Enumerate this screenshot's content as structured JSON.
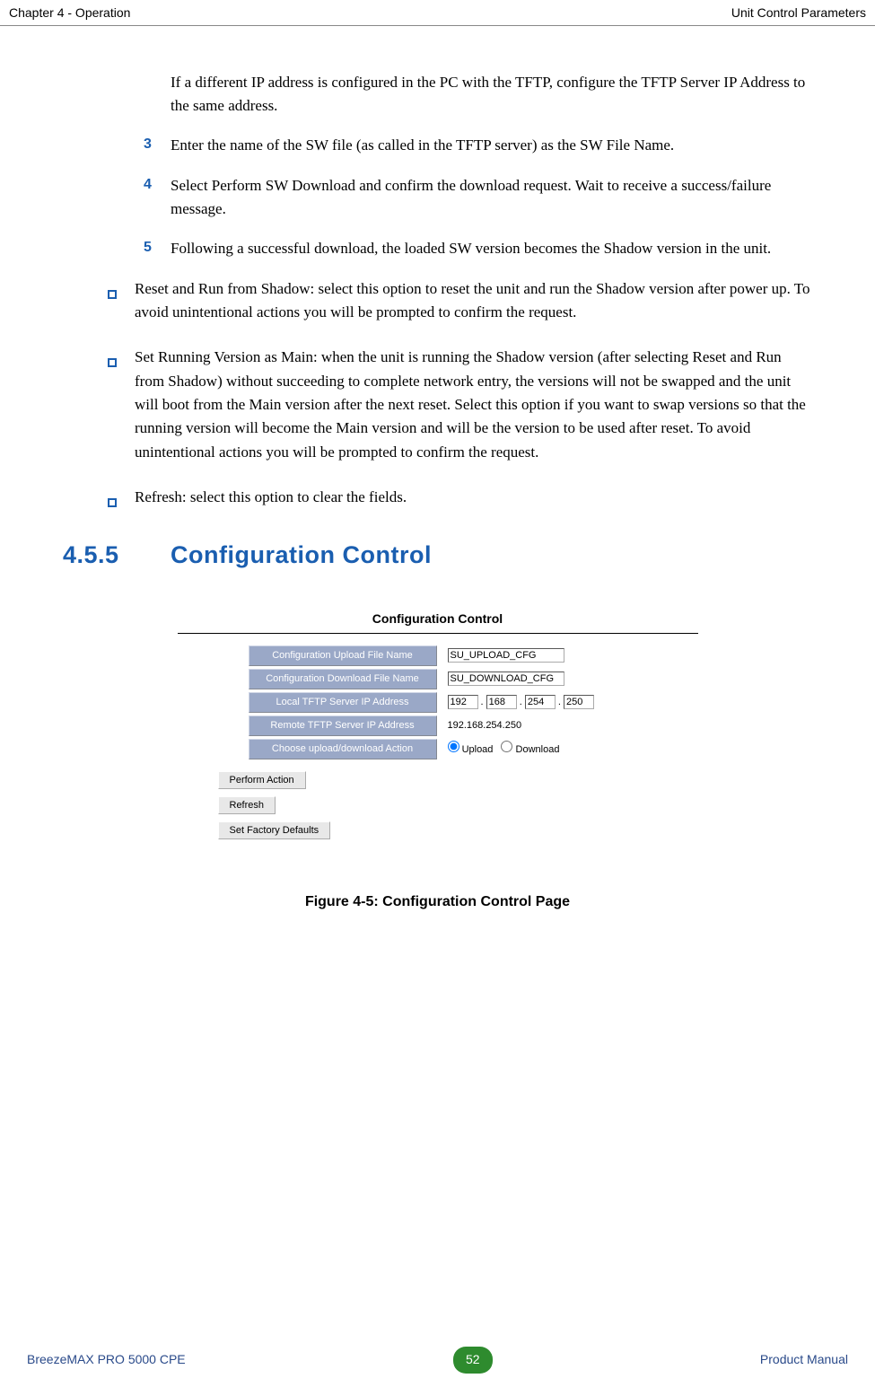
{
  "header": {
    "left": "Chapter 4 - Operation",
    "right": "Unit Control Parameters"
  },
  "body": {
    "intro": "If a different IP address is configured in the PC with the TFTP, configure the TFTP Server IP Address to the same address.",
    "steps": [
      {
        "num": "3",
        "text": "Enter the name of the SW file (as called in the TFTP server) as the SW File Name."
      },
      {
        "num": "4",
        "text": "Select Perform SW Download and confirm the download request. Wait to receive a success/failure message."
      },
      {
        "num": "5",
        "text": "Following a successful download, the loaded SW version becomes the Shadow version in the unit."
      }
    ],
    "bullets": [
      "Reset and Run from Shadow: select this option to reset the unit and run the Shadow version after power up. To avoid unintentional actions you will be prompted to confirm the request.",
      "Set Running Version as Main: when the unit is running the Shadow version (after selecting Reset and Run from Shadow) without succeeding to complete network entry, the versions will not be swapped and the unit will boot from the Main version after the next reset. Select this option if you want to swap versions so that the running version will become the Main version and will be the version to be used after reset. To avoid unintentional actions you will be prompted to confirm the request.",
      "Refresh: select this option to clear the fields."
    ]
  },
  "section": {
    "number": "4.5.5",
    "title": "Configuration Control"
  },
  "figure": {
    "heading": "Configuration Control",
    "rows": {
      "upload_name": {
        "label": "Configuration Upload File Name",
        "value": "SU_UPLOAD_CFG"
      },
      "download_name": {
        "label": "Configuration Download File Name",
        "value": "SU_DOWNLOAD_CFG"
      },
      "local_ip": {
        "label": "Local TFTP Server IP Address",
        "oct1": "192",
        "oct2": "168",
        "oct3": "254",
        "oct4": "250"
      },
      "remote_ip": {
        "label": "Remote TFTP Server IP Address",
        "value": "192.168.254.250"
      },
      "action": {
        "label": "Choose upload/download Action",
        "opt1": "Upload",
        "opt2": "Download"
      }
    },
    "buttons": {
      "perform": "Perform Action",
      "refresh": "Refresh",
      "defaults": "Set Factory Defaults"
    },
    "caption": "Figure 4-5: Configuration Control Page"
  },
  "footer": {
    "left": "BreezeMAX PRO 5000 CPE",
    "page": "52",
    "right": "Product Manual"
  }
}
